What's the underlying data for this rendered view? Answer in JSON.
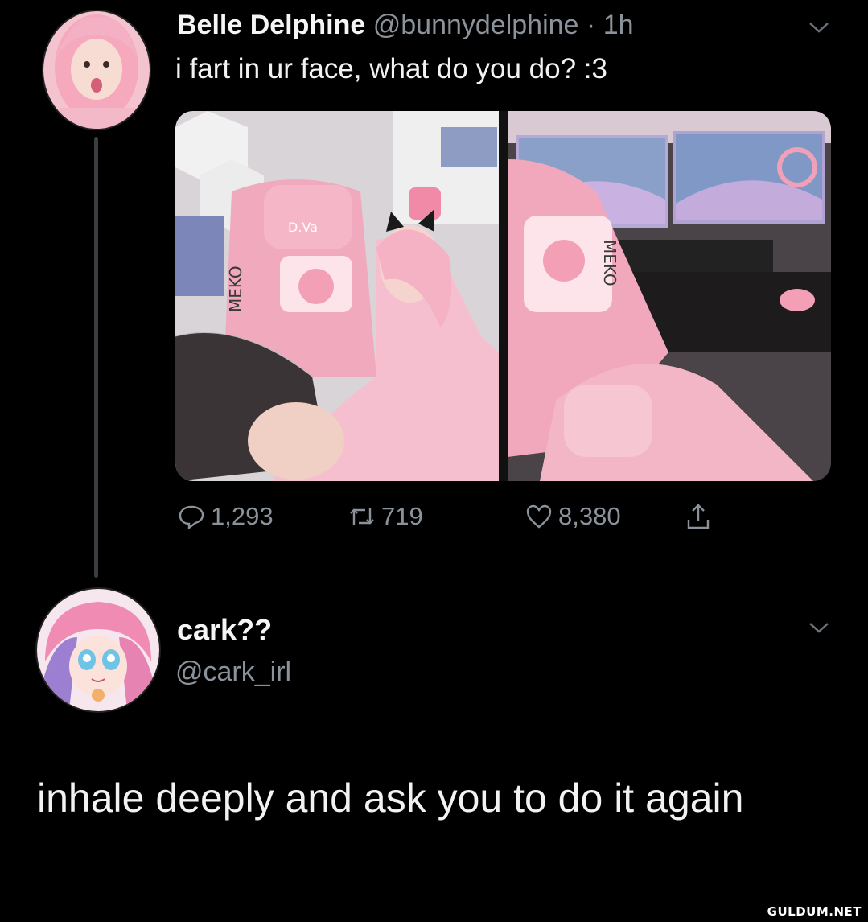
{
  "tweet": {
    "author_name": "Belle Delphine",
    "handle": "@bunnydelphine",
    "separator": "·",
    "time": "1h",
    "text": "i fart in ur face, what do you do? :3",
    "chair_brand": "MEKO",
    "actions": {
      "replies": "1,293",
      "retweets": "719",
      "likes": "8,380"
    }
  },
  "reply": {
    "author_name": "cark??",
    "handle": "@cark_irl",
    "text": "inhale deeply and ask you to do it again"
  },
  "watermark": "GULDUM.NET",
  "colors": {
    "background": "#000000",
    "text": "#f2f2f2",
    "secondary_text": "#8b9299",
    "accent_pink": "#f4b6c8"
  }
}
